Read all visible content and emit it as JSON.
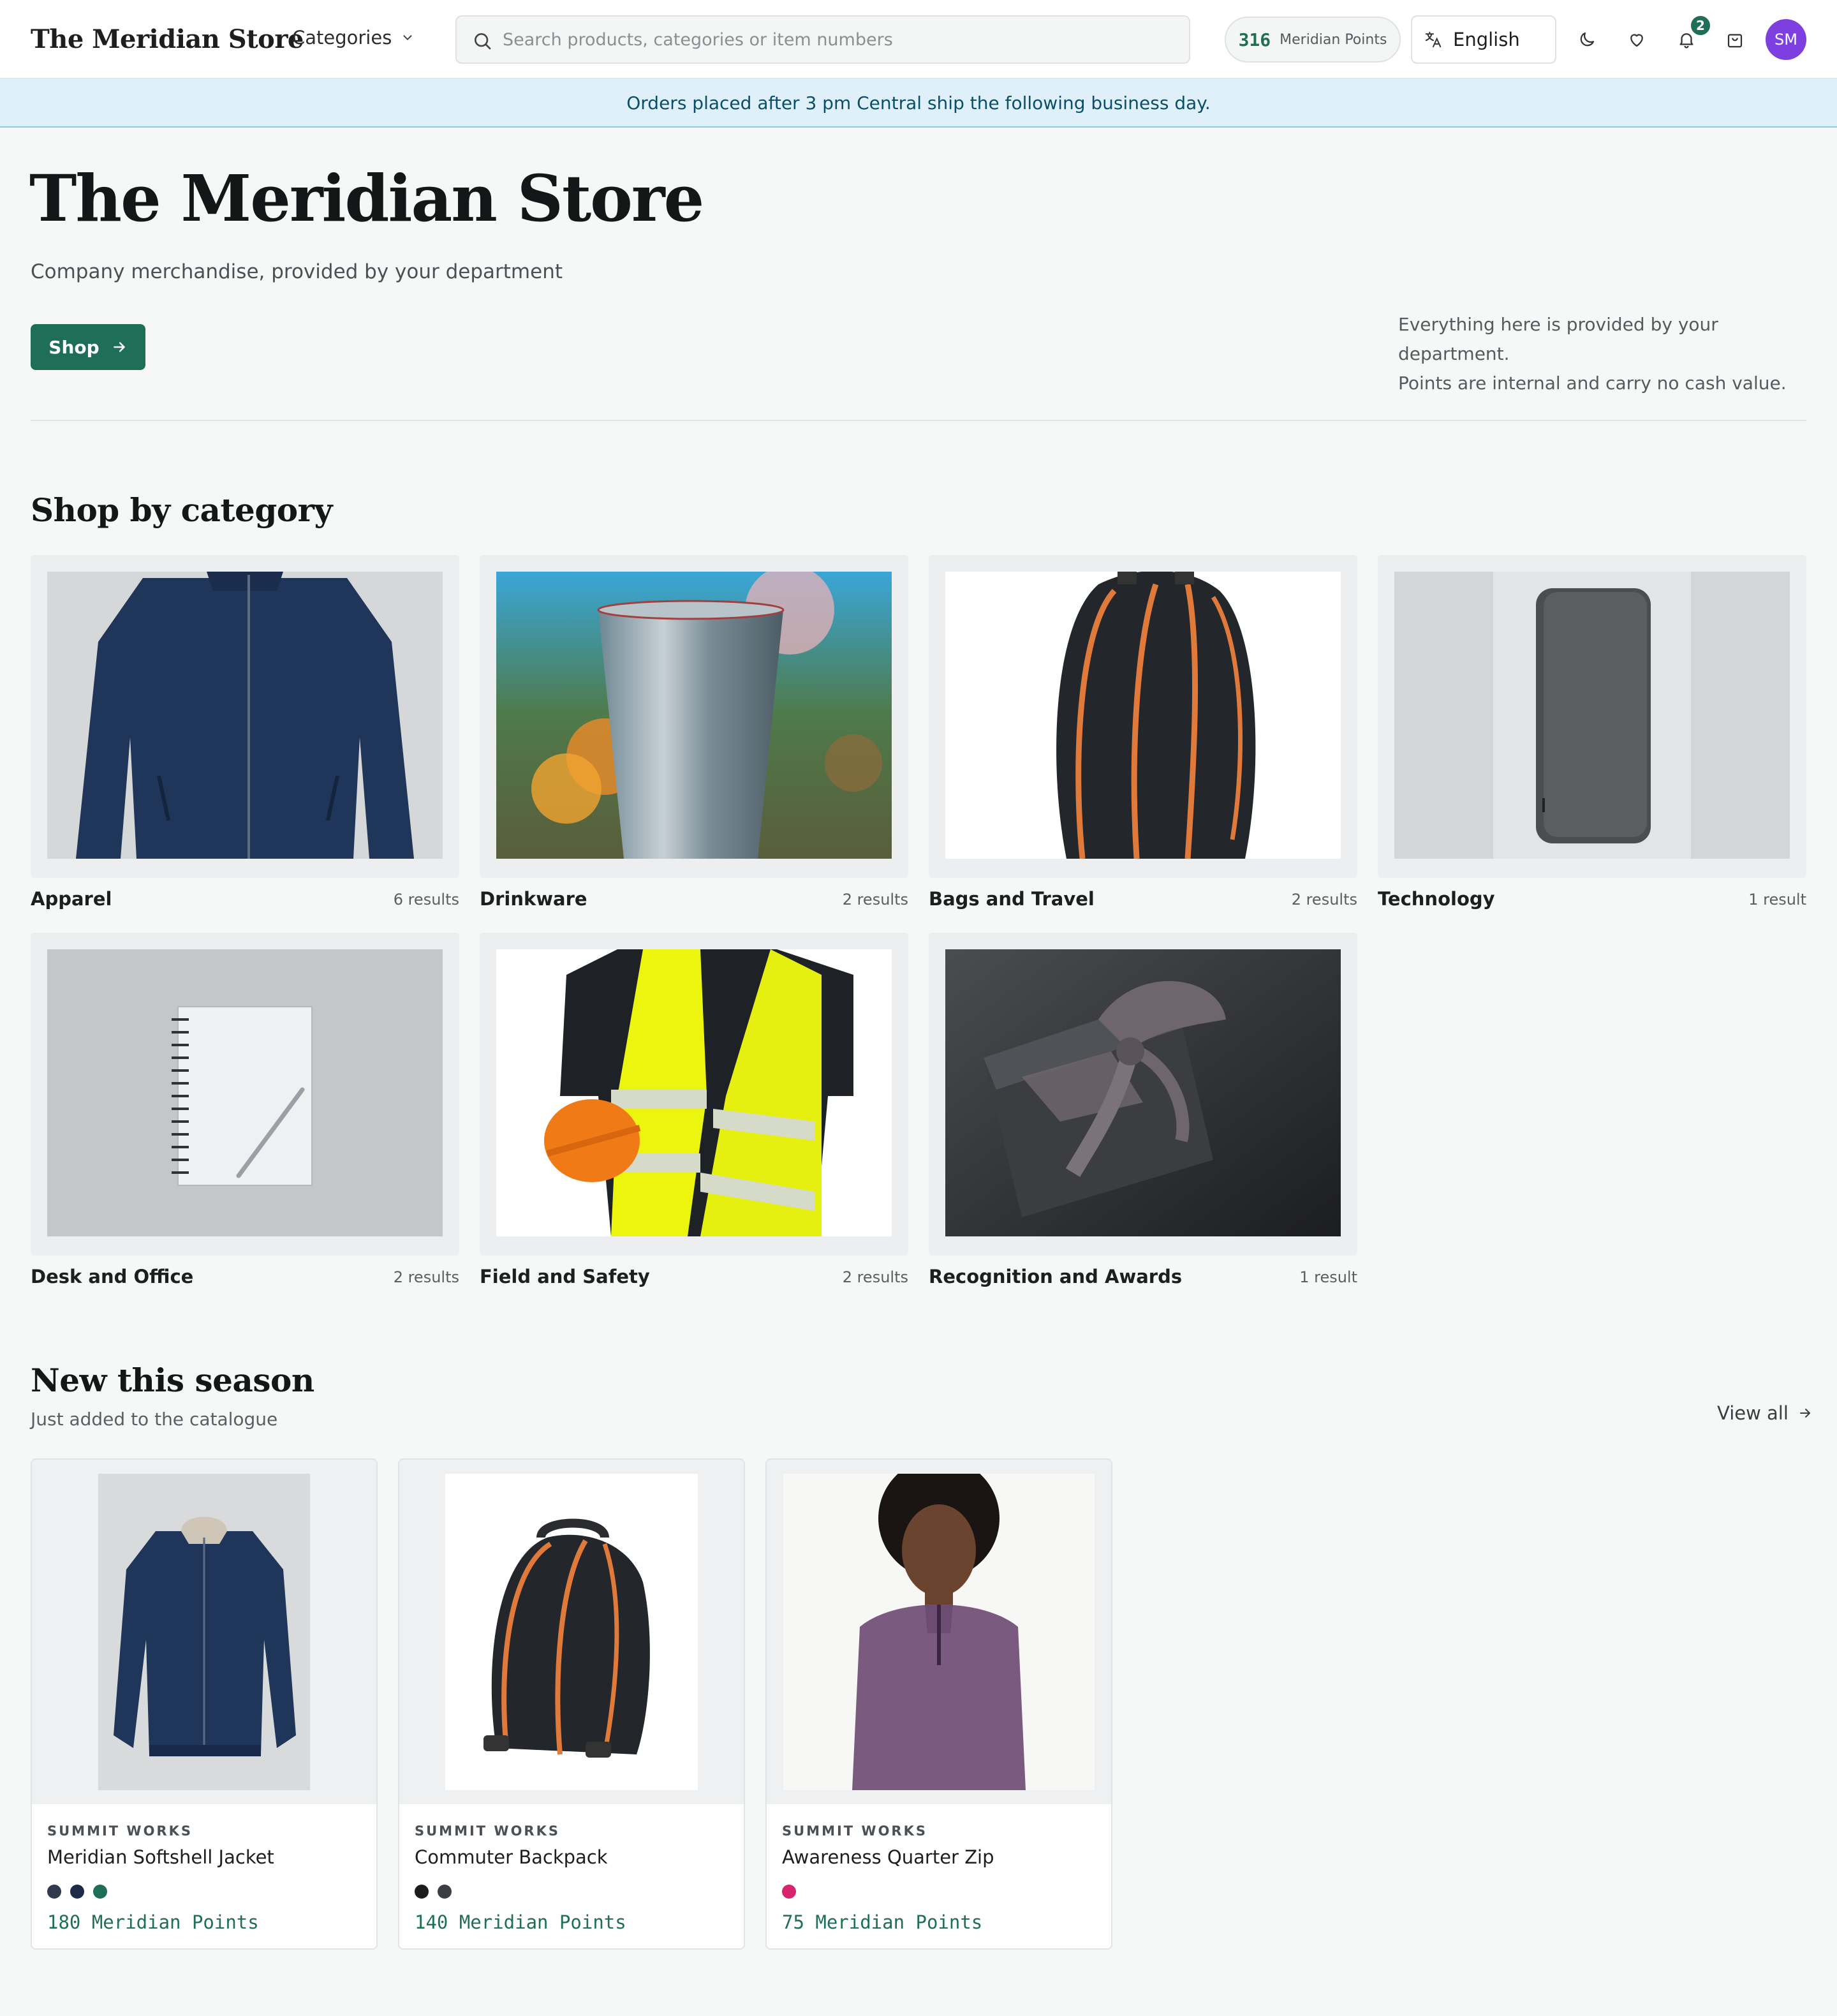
{
  "header": {
    "brand": "The Meridian Store",
    "categories_label": "Categories",
    "search_placeholder": "Search products, categories or item numbers",
    "points_value": "316",
    "points_label": "Meridian Points",
    "language": "English",
    "notification_count": "2",
    "avatar_initials": "SM"
  },
  "banner": {
    "text": "Orders placed after 3 pm Central ship the following business day."
  },
  "hero": {
    "title": "The Meridian Store",
    "subtitle": "Company merchandise, provided by your department",
    "shop_label": "Shop",
    "note_line1": "Everything here is provided by your department.",
    "note_line2": "Points are internal and carry no cash value."
  },
  "categories": {
    "title": "Shop by category",
    "items": [
      {
        "name": "Apparel",
        "count": "6 results"
      },
      {
        "name": "Drinkware",
        "count": "2 results"
      },
      {
        "name": "Bags and Travel",
        "count": "2 results"
      },
      {
        "name": "Technology",
        "count": "1 result"
      },
      {
        "name": "Desk and Office",
        "count": "2 results"
      },
      {
        "name": "Field and Safety",
        "count": "2 results"
      },
      {
        "name": "Recognition and Awards",
        "count": "1 result"
      }
    ]
  },
  "new_season": {
    "title": "New this season",
    "subtitle": "Just added to the catalogue",
    "view_all": "View all",
    "products": [
      {
        "brand": "SUMMIT WORKS",
        "name": "Meridian Softshell Jacket",
        "price": "180 Meridian Points",
        "swatches": [
          "#2f3a4d",
          "#1d2a4a",
          "#1f6e57"
        ]
      },
      {
        "brand": "SUMMIT WORKS",
        "name": "Commuter Backpack",
        "price": "140 Meridian Points",
        "swatches": [
          "#1c1c1c",
          "#3b3f45"
        ]
      },
      {
        "brand": "SUMMIT WORKS",
        "name": "Awareness Quarter Zip",
        "price": "75 Meridian Points",
        "swatches": [
          "#d6246e"
        ]
      }
    ]
  },
  "colors": {
    "accent": "#1f6e57",
    "banner_bg": "#dff0fb",
    "avatar": "#7e3fe0"
  }
}
